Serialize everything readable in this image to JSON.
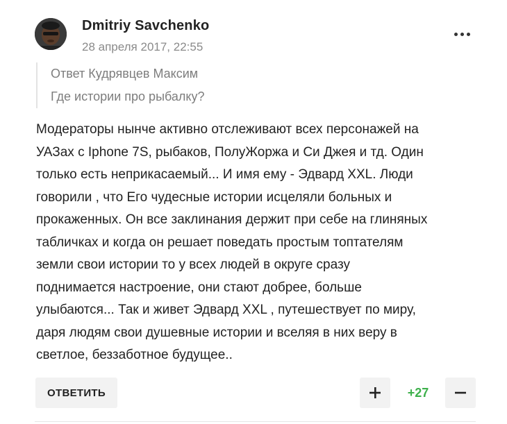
{
  "comment": {
    "author": "Dmitriy Savchenko",
    "date": "28 апреля 2017, 22:55",
    "reply_to": "Ответ Кудрявцев Максим",
    "reply_text": "Где истории про рыбалку?",
    "body_lines": [
      "Модераторы нынче активно отслеживают всех персонажей на",
      "УАЗах с Iphone 7S, рыбаков, ПолуЖоржа и Си Джея и тд. Один",
      "только есть неприкасаемый... И имя ему - Эдвард XXL. Люди",
      "говорили , что Его чудесные истории исцеляли больных и",
      "прокаженных. Он все заклинания держит при себе на глиняных",
      "табличках и когда он решает поведать простым топтателям",
      "земли свои истории то у всех людей в округе сразу",
      "поднимается настроение, они стают добрее, больше",
      "улыбаются... Так и живет Эдвард XXL , путешествует по миру,",
      "даря людям свои душевные истории и вселяя в них веру в",
      "светлое, беззаботное будущее.."
    ],
    "reply_button_label": "ОТВЕТИТЬ",
    "rating": "+27",
    "rating_color": "#3db04b"
  },
  "icons": {
    "more": "more-options-icon",
    "plus": "plus-icon",
    "minus": "minus-icon",
    "avatar": "user-avatar"
  }
}
